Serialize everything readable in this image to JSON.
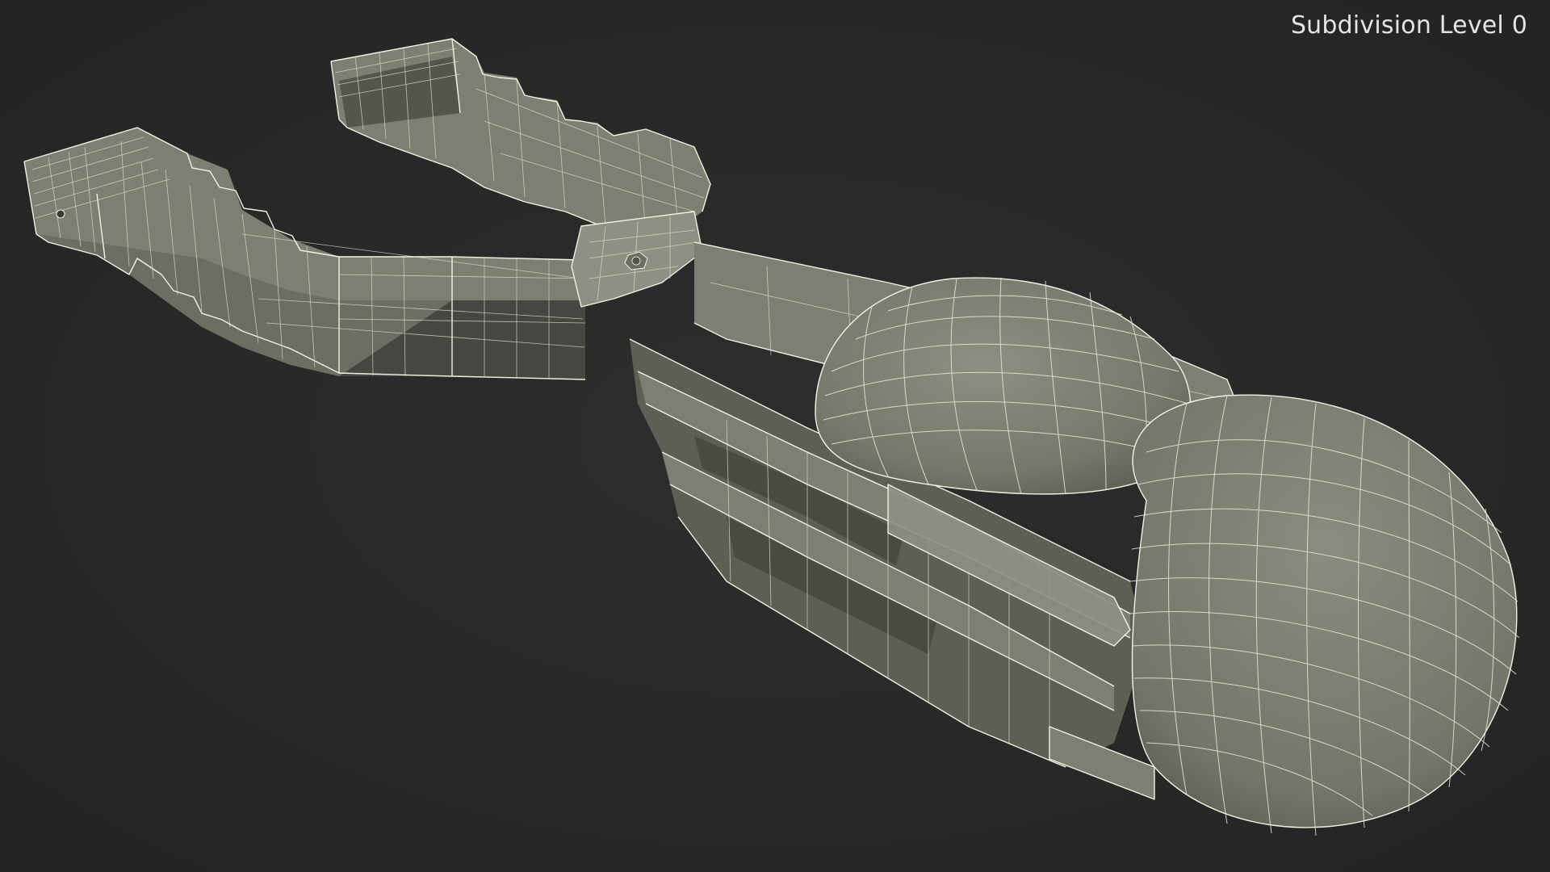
{
  "viewport": {
    "label": "Subdivision Level 0",
    "background_color": "#2a2a2a",
    "mesh_fill_color": "#7e7e72",
    "wire_color": "#f2f2e4"
  }
}
